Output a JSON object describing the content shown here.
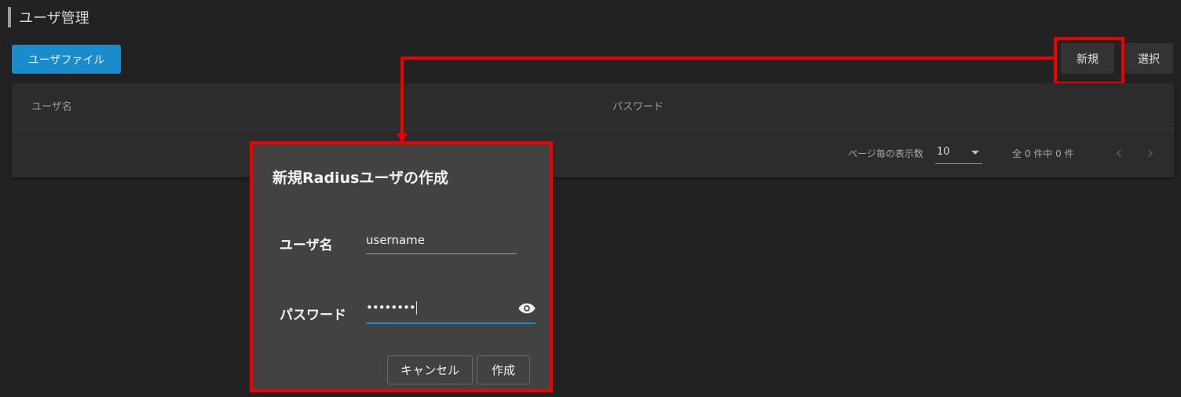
{
  "page": {
    "title": "ユーザ管理"
  },
  "toolbar": {
    "user_file_label": "ユーザファイル",
    "new_label": "新規",
    "select_label": "選択"
  },
  "table": {
    "columns": [
      "ユーザ名",
      "パスワード"
    ],
    "rows": []
  },
  "pagination": {
    "per_page_label": "ページ毎の表示数",
    "per_page_value": "10",
    "count_text": "全 0 件中 0 件",
    "prev_icon": "chevron-left-icon",
    "next_icon": "chevron-right-icon"
  },
  "dialog": {
    "title": "新規Radiusユーザの作成",
    "username_label": "ユーザ名",
    "username_value": "username",
    "password_label": "パスワード",
    "password_value": "••••••••",
    "cancel_label": "キャンセル",
    "create_label": "作成"
  },
  "colors": {
    "accent": "#1a8ccc",
    "annotation": "#ee0000",
    "background": "#222222",
    "dialog_bg": "#424242"
  }
}
